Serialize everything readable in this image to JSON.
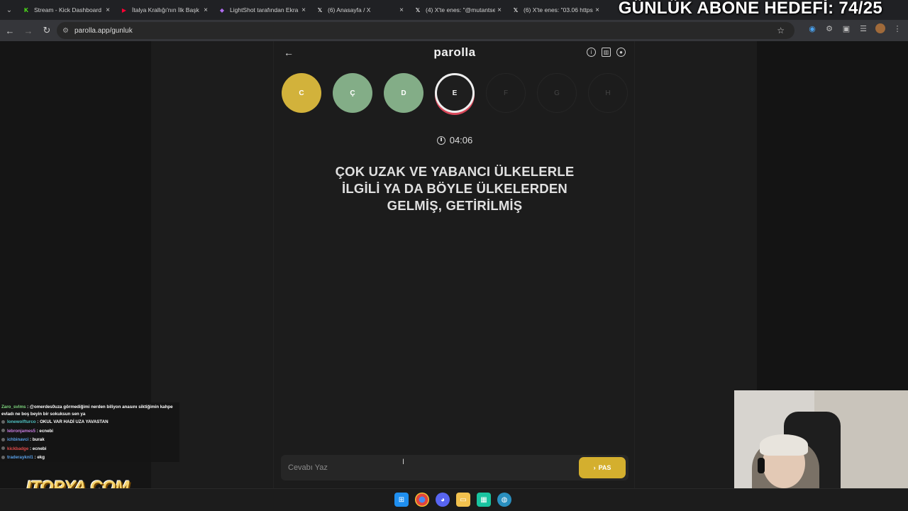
{
  "overlay": {
    "goal_text": "GÜNLÜK ABONE HEDEFİ: 74/25"
  },
  "browser": {
    "tabs": [
      {
        "title": "Stream - Kick Dashboard",
        "icon": "kick-icon",
        "color": "#53fc18"
      },
      {
        "title": "İtalya Krallığı'nın İlk Başk",
        "icon": "youtube-icon",
        "color": "#ff0033"
      },
      {
        "title": "LightShot tarafından Ekra",
        "icon": "lightshot-icon",
        "color": "#b06cf0"
      },
      {
        "title": "(6) Anasayfa / X",
        "icon": "x-icon",
        "color": "#ffffff"
      },
      {
        "title": "(4) X'te enes: \"@mutantse",
        "icon": "x-icon",
        "color": "#ffffff"
      },
      {
        "title": "(6) X'te enes: \"03.06 https",
        "icon": "x-icon",
        "color": "#ffffff"
      }
    ],
    "url": "parolla.app/gunluk"
  },
  "app": {
    "logo": "parolla",
    "letters": [
      {
        "label": "C",
        "state": "correct"
      },
      {
        "label": "Ç",
        "state": "answered"
      },
      {
        "label": "D",
        "state": "answered"
      },
      {
        "label": "E",
        "state": "active"
      },
      {
        "label": "F",
        "state": "pending"
      },
      {
        "label": "G",
        "state": "pending"
      },
      {
        "label": "H",
        "state": "pending"
      }
    ],
    "timer": "04:06",
    "question_lines": [
      "ÇOK UZAK VE YABANCI ÜLKELERLE",
      "İLGİLİ YA DA BÖYLE ÜLKELERDEN",
      "GELMİŞ, GETİRİLMİŞ"
    ],
    "answer_placeholder": "Cevabı Yaz",
    "answer_value": "",
    "pass_label": "PAS",
    "colors": {
      "correct": "#d2b23b",
      "answered": "#83ad87",
      "active_ring": "#d9485a",
      "pass_button": "#d4af2e"
    }
  },
  "chat": {
    "messages": [
      {
        "user": "Zaro_svlms",
        "user_color": "#7fd77f",
        "text": ": @omerdes0uza görmediğimi nerden biliyon anasını siktiğimin kahpe evladı ne boş beyin bir sokuksun sen ya"
      },
      {
        "user": "lonewolfturco",
        "user_color": "#4fc3c3",
        "text": ": OKUL VAR HADİ UZA YAVASTAN"
      },
      {
        "user": "lebronjames5",
        "user_color": "#c97de0",
        "text": ": ecnebi"
      },
      {
        "user": "ichbinavci",
        "user_color": "#5aa0e8",
        "text": ": burak"
      },
      {
        "user": "kickbadge",
        "user_color": "#e04b4b",
        "text": ": ecnebi"
      },
      {
        "user": "traderayknl1",
        "user_color": "#5aa0e8",
        "text": ": ekg"
      }
    ]
  },
  "branding": {
    "sponsor": "ITOPYA.COM"
  }
}
